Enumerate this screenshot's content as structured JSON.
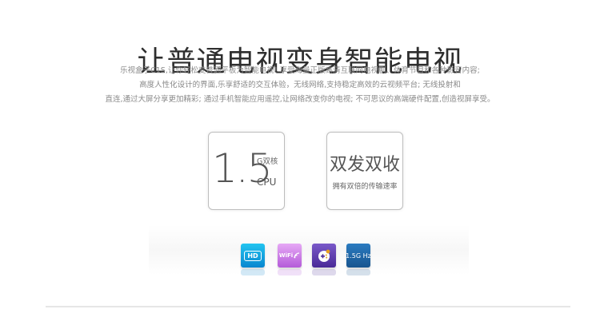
{
  "title": "让普通电视变身智能电视",
  "description": [
    "乐视盒子C1S,让你轻松变普通平板为智能电视! 享受海量正版高清互联网电视剧、体育节目和各种影音内容;",
    "高度人性化设计的界面,乐享舒适的交互体验，无线网络,支持稳定高效的云视频平台; 无线投射和",
    "直连,通过大屏分享更加精彩; 通过手机智能应用遥控,让网络改变你的电视; 不可思议的高端硬件配置,创造视屏享受。"
  ],
  "cards": {
    "cpu": {
      "number": "1.5",
      "superscript": "G双核",
      "unit": "CPU"
    },
    "wifi": {
      "headline": "双发双收",
      "subtitle": "拥有双倍的传输速率"
    }
  },
  "icons": [
    {
      "name": "hd-icon",
      "label": "HD",
      "color": "#0a86cf"
    },
    {
      "name": "wifi-icon",
      "label": "WiFi",
      "color": "#b45bd9"
    },
    {
      "name": "gamepad-icon",
      "label": "",
      "color": "#4a2a97"
    },
    {
      "name": "cpu-speed-icon",
      "label": "1.5G Hz",
      "color": "#18558f"
    }
  ]
}
